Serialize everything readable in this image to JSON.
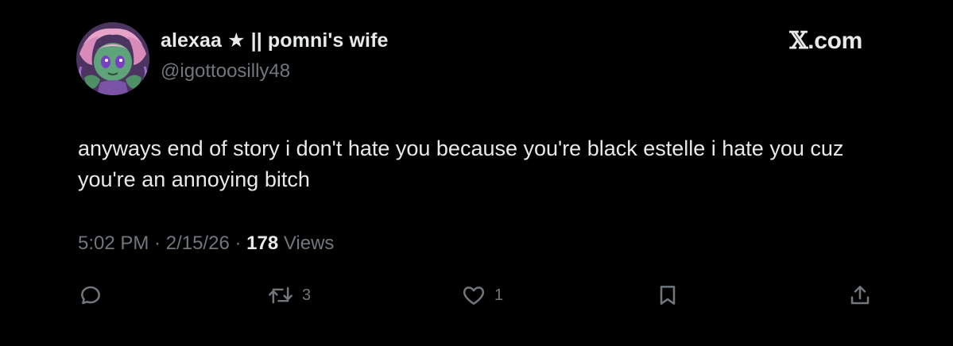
{
  "user": {
    "display_name": "alexaa ★ || pomni's wife",
    "handle": "@igottoosilly48"
  },
  "brand": {
    "glyph": "𝕏",
    "suffix": ".com"
  },
  "tweet": {
    "text": "anyways end of story i don't hate you because you're black estelle i hate you cuz you're an annoying bitch"
  },
  "meta": {
    "time": "5:02 PM",
    "separator": " · ",
    "date": "2/15/26",
    "views_count": "178",
    "views_label": " Views"
  },
  "actions": {
    "reply_count": "",
    "retweet_count": "3",
    "like_count": "1"
  },
  "colors": {
    "background": "#000000",
    "primary_text": "#e7e9ea",
    "secondary_text": "#71767b"
  },
  "icons": {
    "reply": "reply-icon",
    "retweet": "retweet-icon",
    "like": "heart-icon",
    "bookmark": "bookmark-icon",
    "share": "share-icon"
  }
}
